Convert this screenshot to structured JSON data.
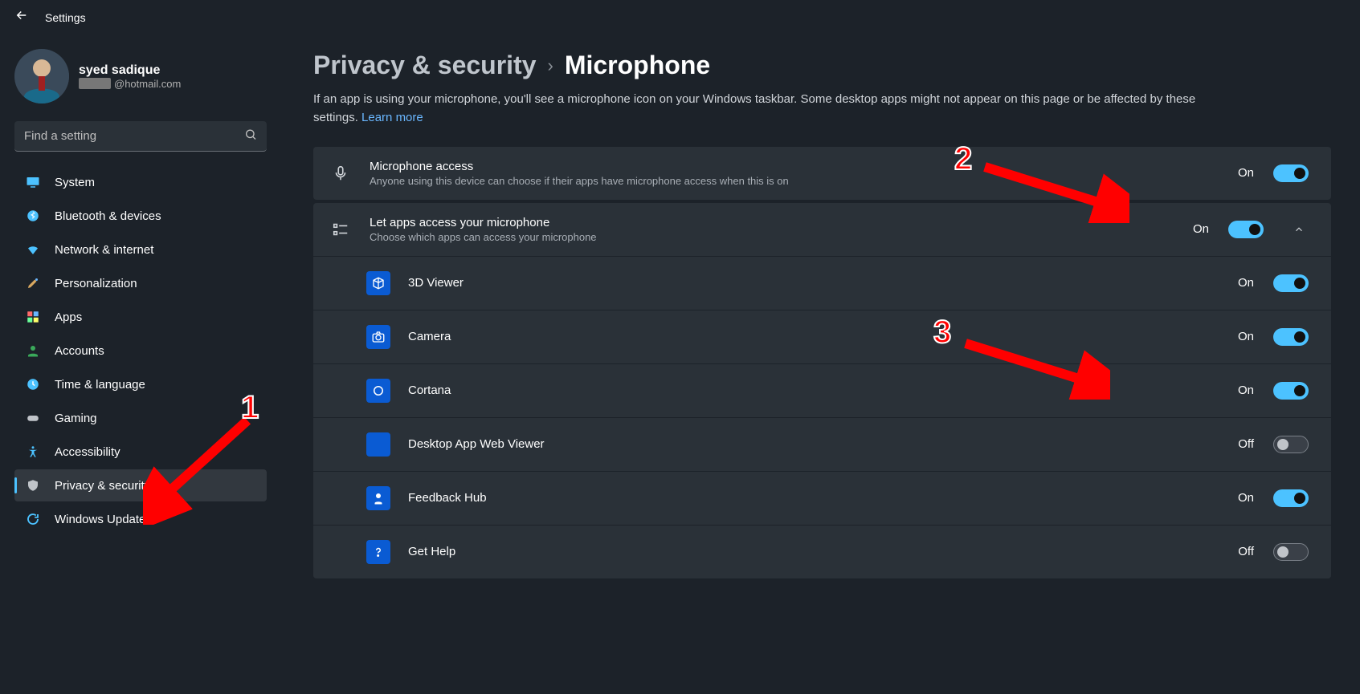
{
  "header": {
    "title": "Settings"
  },
  "user": {
    "name": "syed sadique",
    "email_suffix": "@hotmail.com"
  },
  "search": {
    "placeholder": "Find a setting"
  },
  "nav": {
    "system": "System",
    "bluetooth": "Bluetooth & devices",
    "network": "Network & internet",
    "personalization": "Personalization",
    "apps": "Apps",
    "accounts": "Accounts",
    "time": "Time & language",
    "gaming": "Gaming",
    "accessibility": "Accessibility",
    "privacy": "Privacy & security",
    "update": "Windows Update"
  },
  "breadcrumb": {
    "parent": "Privacy & security",
    "current": "Microphone"
  },
  "intro": {
    "text": "If an app is using your microphone, you'll see a microphone icon on your Windows taskbar. Some desktop apps might not appear on this page or be affected by these settings.  ",
    "learn_more": "Learn more"
  },
  "mic_access": {
    "title": "Microphone access",
    "desc": "Anyone using this device can choose if their apps have microphone access when this is on",
    "state": "On"
  },
  "let_apps": {
    "title": "Let apps access your microphone",
    "desc": "Choose which apps can access your microphone",
    "state": "On"
  },
  "apps_list": [
    {
      "name": "3D Viewer",
      "state": "On",
      "on": true,
      "icon": "cube"
    },
    {
      "name": "Camera",
      "state": "On",
      "on": true,
      "icon": "camera"
    },
    {
      "name": "Cortana",
      "state": "On",
      "on": true,
      "icon": "cortana"
    },
    {
      "name": "Desktop App Web Viewer",
      "state": "Off",
      "on": false,
      "icon": "plain"
    },
    {
      "name": "Feedback Hub",
      "state": "On",
      "on": true,
      "icon": "feedback"
    },
    {
      "name": "Get Help",
      "state": "Off",
      "on": false,
      "icon": "help"
    }
  ],
  "annotations": {
    "n1": "1",
    "n2": "2",
    "n3": "3"
  }
}
